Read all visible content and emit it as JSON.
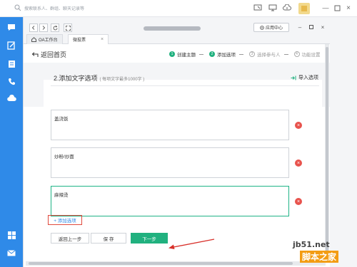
{
  "topbar": {
    "search_placeholder": "搜索联系人、群组、聊天记录等"
  },
  "window": {
    "app_center": "应用中心",
    "tabs": [
      {
        "label": "OA工作台"
      },
      {
        "label": "微投票"
      }
    ]
  },
  "page": {
    "back_label": "返回首页",
    "steps": [
      {
        "num": "1",
        "label": "创建主题",
        "state": "done"
      },
      {
        "num": "2",
        "label": "添加选项",
        "state": "done"
      },
      {
        "num": "3",
        "label": "选择参与人",
        "state": "todo"
      },
      {
        "num": "4",
        "label": "功能设置",
        "state": "todo"
      }
    ],
    "section_title": "2.添加文字选项",
    "section_hint": "( 每项文字最多1000字 )",
    "import_label": "导入选项",
    "options": [
      {
        "value": "盖浇饭"
      },
      {
        "value": "炒粉/炒面"
      },
      {
        "value": "麻辣烫"
      }
    ],
    "add_option_label": "+ 添加选项",
    "prev_button": "返回上一步",
    "save_button": "保 存",
    "next_button": "下一步"
  },
  "colors": {
    "accent_green": "#21b17f",
    "nav_blue": "#2f8ae8",
    "delete_red": "#e8534d",
    "highlight_red": "#e04a3e"
  },
  "watermark": {
    "line1": "jb51.net",
    "line2": "脚本之家"
  }
}
